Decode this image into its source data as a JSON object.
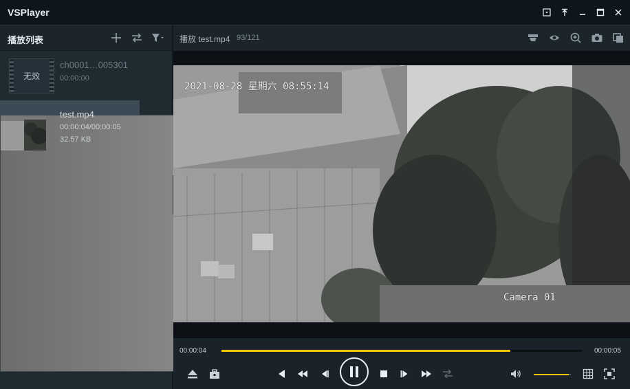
{
  "app": {
    "title": "VSPlayer"
  },
  "sidebar": {
    "title": "播放列表",
    "items": [
      {
        "name": "ch0001…005301",
        "duration": "00:00:00",
        "thumb_label": "无效",
        "active": false
      },
      {
        "name": "test.mp4",
        "duration": "00:00:04/00:00:05",
        "size": "32.57 KB",
        "active": true
      }
    ]
  },
  "player": {
    "status_label": "播放",
    "file_name": "test.mp4",
    "frame_count": "93/121",
    "osd_timestamp": "2021-08-28 星期六 08:55:14",
    "osd_camera": "Camera 01"
  },
  "controls": {
    "current_time": "00:00:04",
    "total_time": "00:00:05",
    "progress": 0.8,
    "volume": 0.95
  },
  "colors": {
    "accent": "#f3c400",
    "background": "#11181d"
  }
}
